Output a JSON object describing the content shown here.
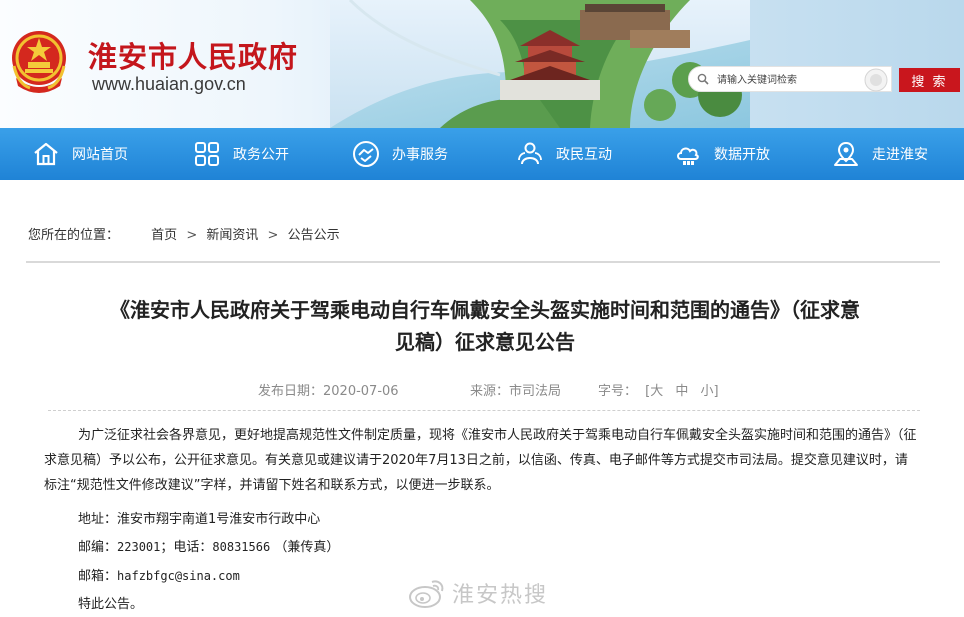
{
  "header": {
    "site_title": "淮安市人民政府",
    "site_url": "www.huaian.gov.cn",
    "search_placeholder": "请输入关键词检索",
    "search_button": "搜 索"
  },
  "nav": {
    "items": [
      {
        "label": "网站首页",
        "icon": "home-icon"
      },
      {
        "label": "政务公开",
        "icon": "grid-icon"
      },
      {
        "label": "办事服务",
        "icon": "handshake-icon"
      },
      {
        "label": "政民互动",
        "icon": "people-icon"
      },
      {
        "label": "数据开放",
        "icon": "cloud-data-icon"
      },
      {
        "label": "走进淮安",
        "icon": "map-pin-icon"
      }
    ]
  },
  "breadcrumb": {
    "prefix": "您所在的位置：",
    "items": [
      "首页",
      "新闻资讯",
      "公告公示"
    ],
    "separator": ">"
  },
  "article": {
    "title_line1": "《淮安市人民政府关于驾乘电动自行车佩戴安全头盔实施时间和范围的通告》（征求意",
    "title_line2": "见稿）征求意见公告",
    "date_label": "发布日期：",
    "date": "2020-07-06",
    "source_label": "来源：",
    "source": "市司法局",
    "font_label": "字号：",
    "font_sizes": [
      "[大",
      "中",
      "小]"
    ],
    "paragraph": "为广泛征求社会各界意见，更好地提高规范性文件制定质量，现将《淮安市人民政府关于驾乘电动自行车佩戴安全头盔实施时间和范围的通告》（征求意见稿）予以公布，公开征求意见。有关意见或建议请于2020年7月13日之前，以信函、传真、电子邮件等方式提交市司法局。提交意见建议时，请标注“规范性文件修改建议”字样，并请留下姓名和联系方式，以便进一步联系。",
    "address_label": "地址：",
    "address": "淮安市翔宇南道1号淮安市行政中心",
    "postcode_label": "邮编：",
    "postcode": "223001",
    "phone_label": "；电话：",
    "phone": "80831566",
    "phone_note": "（兼传真）",
    "email_label": "邮箱：",
    "email": "hafzbfgc@sina.com",
    "closing": "特此公告。"
  },
  "watermark": {
    "text": "淮安热搜",
    "icon": "weibo-icon"
  },
  "colors": {
    "brand_red": "#c4161c",
    "nav_blue": "#1f83d6",
    "search_button": "#c9161d"
  }
}
